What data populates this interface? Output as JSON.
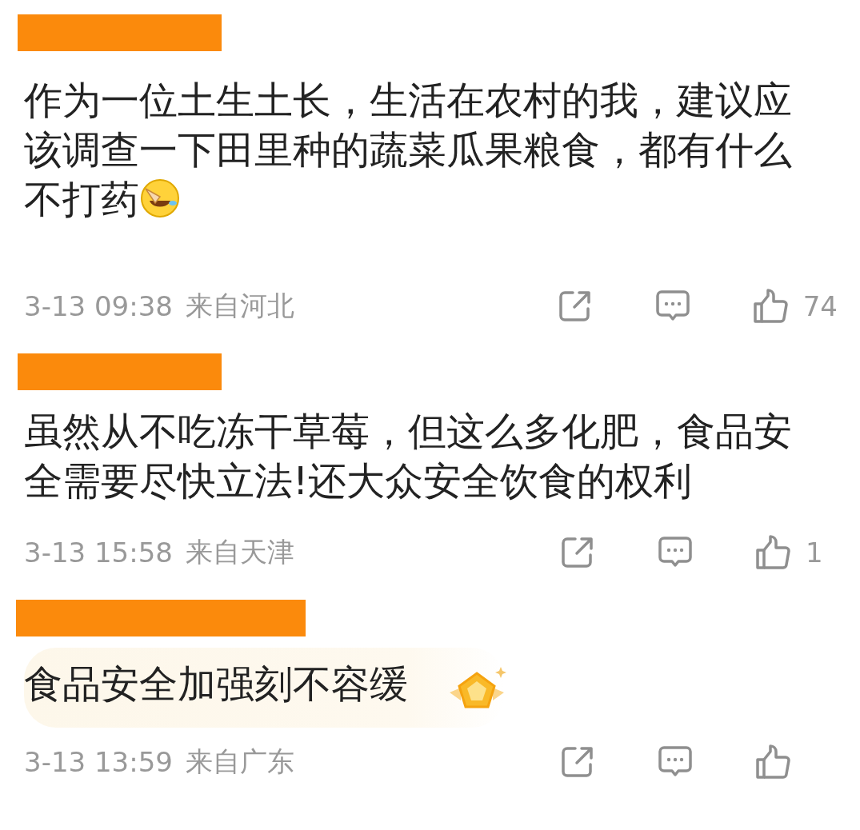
{
  "comments": [
    {
      "text": "作为一位土生土长，生活在农村的我，建议应该调查一下田里种的蔬菜瓜果粮食，都有什么不打药",
      "emoji": true,
      "decorated": false,
      "time": "3-13 09:38",
      "location": "来自河北",
      "likes": "74"
    },
    {
      "text": "虽然从不吃冻干草莓，但这么多化肥，食品安全需要尽快立法!还大众安全饮食的权利",
      "emoji": false,
      "decorated": false,
      "time": "3-13 15:58",
      "location": "来自天津",
      "likes": "1"
    },
    {
      "text": "食品安全加强刻不容缓",
      "emoji": false,
      "decorated": true,
      "time": "3-13 13:59",
      "location": "来自广东"
    }
  ]
}
